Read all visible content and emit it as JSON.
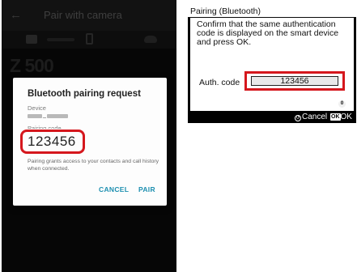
{
  "phone": {
    "app_bar": {
      "back_icon": "arrow-back-icon",
      "title": "Pair with camera"
    },
    "toolbar": {
      "icons": [
        "camera-icon",
        "smartphone-icon",
        "cloud-icon"
      ]
    },
    "model_text": "Z 500",
    "dialog": {
      "title": "Bluetooth pairing request",
      "device_label": "Device",
      "device_name": "_",
      "code_label": "Pairing code",
      "code": "123456",
      "info": "Pairing grants access to your contacts and call history when connected.",
      "cancel_label": "CANCEL",
      "pair_label": "PAIR",
      "button_color": "#1d8fb0"
    },
    "highlight_color": "#d5171d"
  },
  "camera": {
    "header_title": "Pairing (Bluetooth)",
    "message": "Confirm that the same authentication code is displayed on the smart device and press OK.",
    "auth_label": "Auth. code",
    "auth_code": "123456",
    "badge": "0",
    "footer": {
      "cancel_icon": "↺",
      "cancel_label": "Cancel",
      "ok_icon": "OK",
      "ok_label": "OK"
    }
  }
}
